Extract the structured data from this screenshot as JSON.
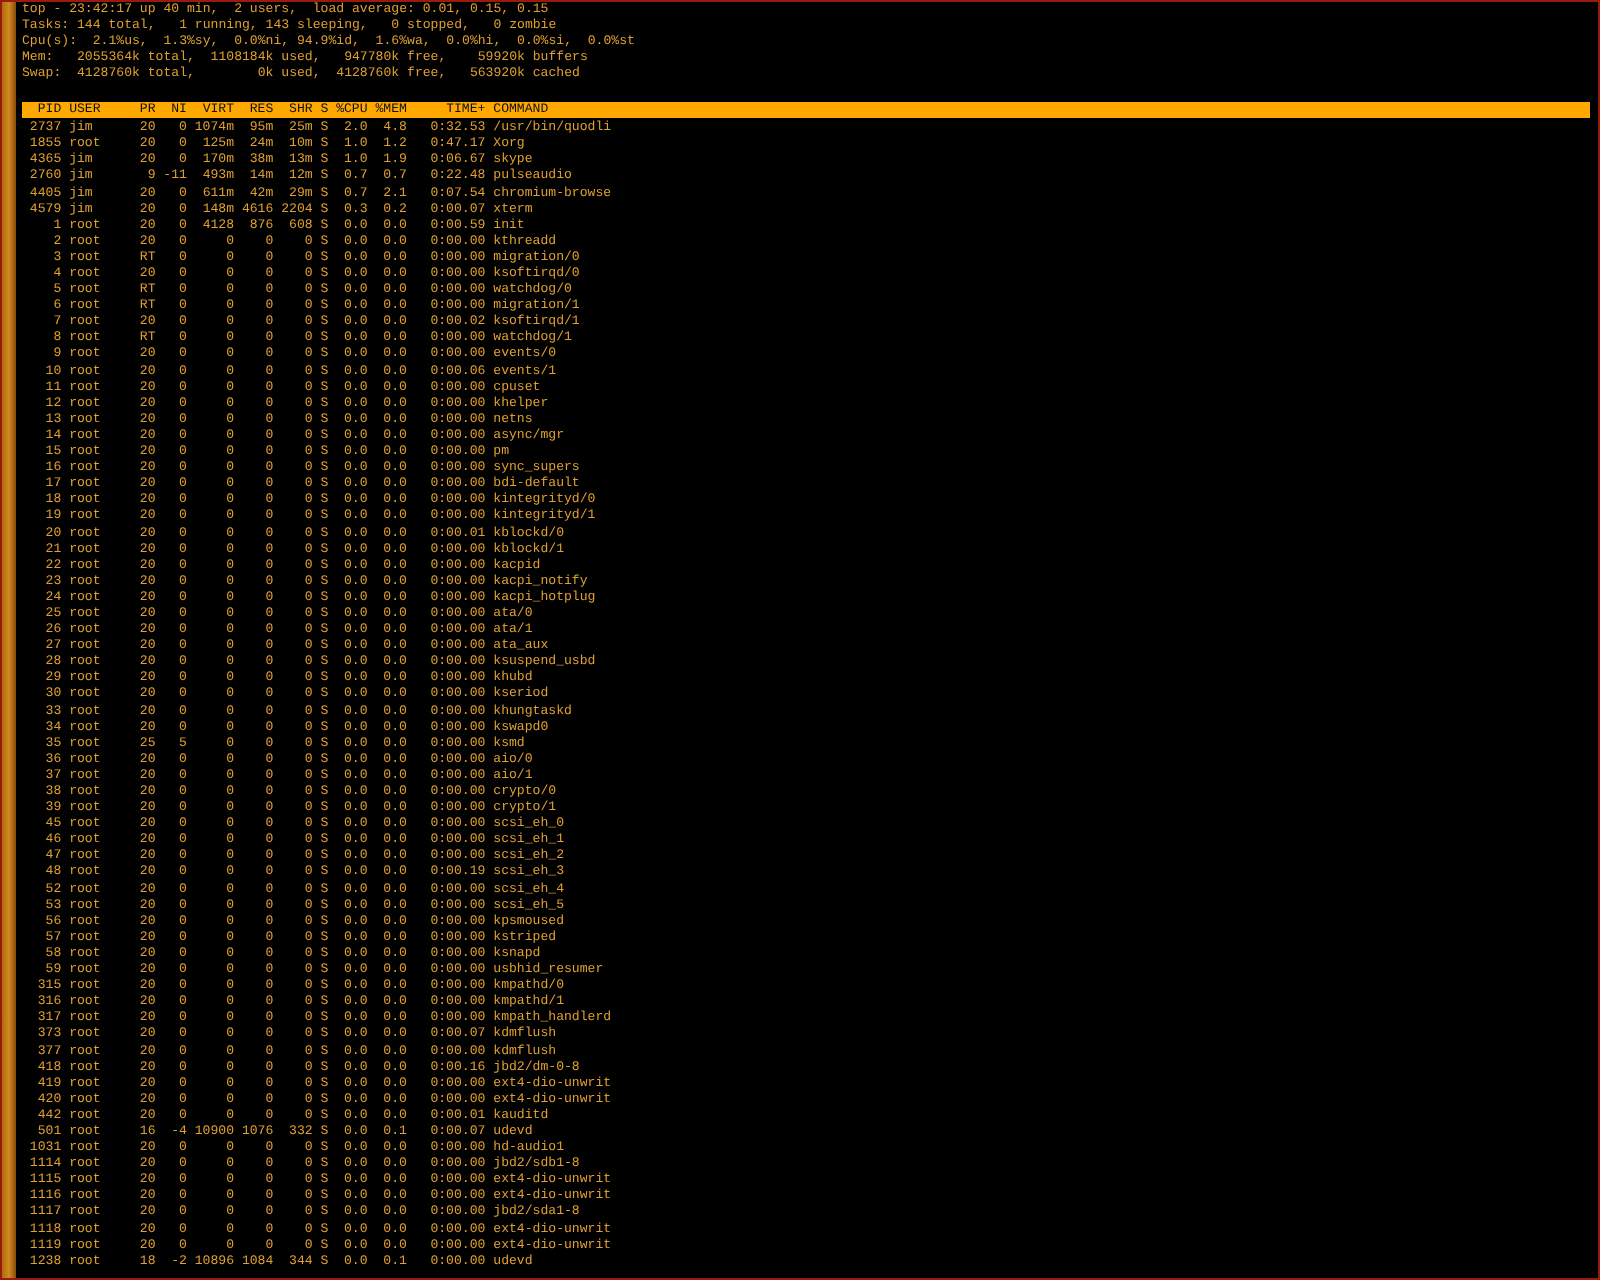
{
  "summary": [
    "top - 23:42:17 up 40 min,  2 users,  load average: 0.01, 0.15, 0.15",
    "Tasks: 144 total,   1 running, 143 sleeping,   0 stopped,   0 zombie",
    "Cpu(s):  2.1%us,  1.3%sy,  0.0%ni, 94.9%id,  1.6%wa,  0.0%hi,  0.0%si,  0.0%st",
    "Mem:   2055364k total,  1108184k used,   947780k free,    59920k buffers",
    "Swap:  4128760k total,        0k used,  4128760k free,   563920k cached"
  ],
  "table": {
    "columns": [
      "PID",
      "USER",
      "PR",
      "NI",
      "VIRT",
      "RES",
      "SHR",
      "S",
      "%CPU",
      "%MEM",
      "TIME+",
      "COMMAND"
    ],
    "rows": [
      [
        "2737",
        "jim",
        "20",
        "0",
        "1074m",
        "95m",
        "25m",
        "S",
        "2.0",
        "4.8",
        "0:32.53",
        "/usr/bin/quodli"
      ],
      [
        "1855",
        "root",
        "20",
        "0",
        "125m",
        "24m",
        "10m",
        "S",
        "1.0",
        "1.2",
        "0:47.17",
        "Xorg"
      ],
      [
        "4365",
        "jim",
        "20",
        "0",
        "170m",
        "38m",
        "13m",
        "S",
        "1.0",
        "1.9",
        "0:06.67",
        "skype"
      ],
      [
        "2760",
        "jim",
        "9",
        "-11",
        "493m",
        "14m",
        "12m",
        "S",
        "0.7",
        "0.7",
        "0:22.48",
        "pulseaudio"
      ],
      [
        "4405",
        "jim",
        "20",
        "0",
        "611m",
        "42m",
        "29m",
        "S",
        "0.7",
        "2.1",
        "0:07.54",
        "chromium-browse"
      ],
      [
        "4579",
        "jim",
        "20",
        "0",
        "148m",
        "4616",
        "2204",
        "S",
        "0.3",
        "0.2",
        "0:00.07",
        "xterm"
      ],
      [
        "1",
        "root",
        "20",
        "0",
        "4128",
        "876",
        "608",
        "S",
        "0.0",
        "0.0",
        "0:00.59",
        "init"
      ],
      [
        "2",
        "root",
        "20",
        "0",
        "0",
        "0",
        "0",
        "S",
        "0.0",
        "0.0",
        "0:00.00",
        "kthreadd"
      ],
      [
        "3",
        "root",
        "RT",
        "0",
        "0",
        "0",
        "0",
        "S",
        "0.0",
        "0.0",
        "0:00.00",
        "migration/0"
      ],
      [
        "4",
        "root",
        "20",
        "0",
        "0",
        "0",
        "0",
        "S",
        "0.0",
        "0.0",
        "0:00.00",
        "ksoftirqd/0"
      ],
      [
        "5",
        "root",
        "RT",
        "0",
        "0",
        "0",
        "0",
        "S",
        "0.0",
        "0.0",
        "0:00.00",
        "watchdog/0"
      ],
      [
        "6",
        "root",
        "RT",
        "0",
        "0",
        "0",
        "0",
        "S",
        "0.0",
        "0.0",
        "0:00.00",
        "migration/1"
      ],
      [
        "7",
        "root",
        "20",
        "0",
        "0",
        "0",
        "0",
        "S",
        "0.0",
        "0.0",
        "0:00.02",
        "ksoftirqd/1"
      ],
      [
        "8",
        "root",
        "RT",
        "0",
        "0",
        "0",
        "0",
        "S",
        "0.0",
        "0.0",
        "0:00.00",
        "watchdog/1"
      ],
      [
        "9",
        "root",
        "20",
        "0",
        "0",
        "0",
        "0",
        "S",
        "0.0",
        "0.0",
        "0:00.00",
        "events/0"
      ],
      [
        "10",
        "root",
        "20",
        "0",
        "0",
        "0",
        "0",
        "S",
        "0.0",
        "0.0",
        "0:00.06",
        "events/1"
      ],
      [
        "11",
        "root",
        "20",
        "0",
        "0",
        "0",
        "0",
        "S",
        "0.0",
        "0.0",
        "0:00.00",
        "cpuset"
      ],
      [
        "12",
        "root",
        "20",
        "0",
        "0",
        "0",
        "0",
        "S",
        "0.0",
        "0.0",
        "0:00.00",
        "khelper"
      ],
      [
        "13",
        "root",
        "20",
        "0",
        "0",
        "0",
        "0",
        "S",
        "0.0",
        "0.0",
        "0:00.00",
        "netns"
      ],
      [
        "14",
        "root",
        "20",
        "0",
        "0",
        "0",
        "0",
        "S",
        "0.0",
        "0.0",
        "0:00.00",
        "async/mgr"
      ],
      [
        "15",
        "root",
        "20",
        "0",
        "0",
        "0",
        "0",
        "S",
        "0.0",
        "0.0",
        "0:00.00",
        "pm"
      ],
      [
        "16",
        "root",
        "20",
        "0",
        "0",
        "0",
        "0",
        "S",
        "0.0",
        "0.0",
        "0:00.00",
        "sync_supers"
      ],
      [
        "17",
        "root",
        "20",
        "0",
        "0",
        "0",
        "0",
        "S",
        "0.0",
        "0.0",
        "0:00.00",
        "bdi-default"
      ],
      [
        "18",
        "root",
        "20",
        "0",
        "0",
        "0",
        "0",
        "S",
        "0.0",
        "0.0",
        "0:00.00",
        "kintegrityd/0"
      ],
      [
        "19",
        "root",
        "20",
        "0",
        "0",
        "0",
        "0",
        "S",
        "0.0",
        "0.0",
        "0:00.00",
        "kintegrityd/1"
      ],
      [
        "20",
        "root",
        "20",
        "0",
        "0",
        "0",
        "0",
        "S",
        "0.0",
        "0.0",
        "0:00.01",
        "kblockd/0"
      ],
      [
        "21",
        "root",
        "20",
        "0",
        "0",
        "0",
        "0",
        "S",
        "0.0",
        "0.0",
        "0:00.00",
        "kblockd/1"
      ],
      [
        "22",
        "root",
        "20",
        "0",
        "0",
        "0",
        "0",
        "S",
        "0.0",
        "0.0",
        "0:00.00",
        "kacpid"
      ],
      [
        "23",
        "root",
        "20",
        "0",
        "0",
        "0",
        "0",
        "S",
        "0.0",
        "0.0",
        "0:00.00",
        "kacpi_notify"
      ],
      [
        "24",
        "root",
        "20",
        "0",
        "0",
        "0",
        "0",
        "S",
        "0.0",
        "0.0",
        "0:00.00",
        "kacpi_hotplug"
      ],
      [
        "25",
        "root",
        "20",
        "0",
        "0",
        "0",
        "0",
        "S",
        "0.0",
        "0.0",
        "0:00.00",
        "ata/0"
      ],
      [
        "26",
        "root",
        "20",
        "0",
        "0",
        "0",
        "0",
        "S",
        "0.0",
        "0.0",
        "0:00.00",
        "ata/1"
      ],
      [
        "27",
        "root",
        "20",
        "0",
        "0",
        "0",
        "0",
        "S",
        "0.0",
        "0.0",
        "0:00.00",
        "ata_aux"
      ],
      [
        "28",
        "root",
        "20",
        "0",
        "0",
        "0",
        "0",
        "S",
        "0.0",
        "0.0",
        "0:00.00",
        "ksuspend_usbd"
      ],
      [
        "29",
        "root",
        "20",
        "0",
        "0",
        "0",
        "0",
        "S",
        "0.0",
        "0.0",
        "0:00.00",
        "khubd"
      ],
      [
        "30",
        "root",
        "20",
        "0",
        "0",
        "0",
        "0",
        "S",
        "0.0",
        "0.0",
        "0:00.00",
        "kseriod"
      ],
      [
        "33",
        "root",
        "20",
        "0",
        "0",
        "0",
        "0",
        "S",
        "0.0",
        "0.0",
        "0:00.00",
        "khungtaskd"
      ],
      [
        "34",
        "root",
        "20",
        "0",
        "0",
        "0",
        "0",
        "S",
        "0.0",
        "0.0",
        "0:00.00",
        "kswapd0"
      ],
      [
        "35",
        "root",
        "25",
        "5",
        "0",
        "0",
        "0",
        "S",
        "0.0",
        "0.0",
        "0:00.00",
        "ksmd"
      ],
      [
        "36",
        "root",
        "20",
        "0",
        "0",
        "0",
        "0",
        "S",
        "0.0",
        "0.0",
        "0:00.00",
        "aio/0"
      ],
      [
        "37",
        "root",
        "20",
        "0",
        "0",
        "0",
        "0",
        "S",
        "0.0",
        "0.0",
        "0:00.00",
        "aio/1"
      ],
      [
        "38",
        "root",
        "20",
        "0",
        "0",
        "0",
        "0",
        "S",
        "0.0",
        "0.0",
        "0:00.00",
        "crypto/0"
      ],
      [
        "39",
        "root",
        "20",
        "0",
        "0",
        "0",
        "0",
        "S",
        "0.0",
        "0.0",
        "0:00.00",
        "crypto/1"
      ],
      [
        "45",
        "root",
        "20",
        "0",
        "0",
        "0",
        "0",
        "S",
        "0.0",
        "0.0",
        "0:00.00",
        "scsi_eh_0"
      ],
      [
        "46",
        "root",
        "20",
        "0",
        "0",
        "0",
        "0",
        "S",
        "0.0",
        "0.0",
        "0:00.00",
        "scsi_eh_1"
      ],
      [
        "47",
        "root",
        "20",
        "0",
        "0",
        "0",
        "0",
        "S",
        "0.0",
        "0.0",
        "0:00.00",
        "scsi_eh_2"
      ],
      [
        "48",
        "root",
        "20",
        "0",
        "0",
        "0",
        "0",
        "S",
        "0.0",
        "0.0",
        "0:00.19",
        "scsi_eh_3"
      ],
      [
        "52",
        "root",
        "20",
        "0",
        "0",
        "0",
        "0",
        "S",
        "0.0",
        "0.0",
        "0:00.00",
        "scsi_eh_4"
      ],
      [
        "53",
        "root",
        "20",
        "0",
        "0",
        "0",
        "0",
        "S",
        "0.0",
        "0.0",
        "0:00.00",
        "scsi_eh_5"
      ],
      [
        "56",
        "root",
        "20",
        "0",
        "0",
        "0",
        "0",
        "S",
        "0.0",
        "0.0",
        "0:00.00",
        "kpsmoused"
      ],
      [
        "57",
        "root",
        "20",
        "0",
        "0",
        "0",
        "0",
        "S",
        "0.0",
        "0.0",
        "0:00.00",
        "kstriped"
      ],
      [
        "58",
        "root",
        "20",
        "0",
        "0",
        "0",
        "0",
        "S",
        "0.0",
        "0.0",
        "0:00.00",
        "ksnapd"
      ],
      [
        "59",
        "root",
        "20",
        "0",
        "0",
        "0",
        "0",
        "S",
        "0.0",
        "0.0",
        "0:00.00",
        "usbhid_resumer"
      ],
      [
        "315",
        "root",
        "20",
        "0",
        "0",
        "0",
        "0",
        "S",
        "0.0",
        "0.0",
        "0:00.00",
        "kmpathd/0"
      ],
      [
        "316",
        "root",
        "20",
        "0",
        "0",
        "0",
        "0",
        "S",
        "0.0",
        "0.0",
        "0:00.00",
        "kmpathd/1"
      ],
      [
        "317",
        "root",
        "20",
        "0",
        "0",
        "0",
        "0",
        "S",
        "0.0",
        "0.0",
        "0:00.00",
        "kmpath_handlerd"
      ],
      [
        "373",
        "root",
        "20",
        "0",
        "0",
        "0",
        "0",
        "S",
        "0.0",
        "0.0",
        "0:00.07",
        "kdmflush"
      ],
      [
        "377",
        "root",
        "20",
        "0",
        "0",
        "0",
        "0",
        "S",
        "0.0",
        "0.0",
        "0:00.00",
        "kdmflush"
      ],
      [
        "418",
        "root",
        "20",
        "0",
        "0",
        "0",
        "0",
        "S",
        "0.0",
        "0.0",
        "0:00.16",
        "jbd2/dm-0-8"
      ],
      [
        "419",
        "root",
        "20",
        "0",
        "0",
        "0",
        "0",
        "S",
        "0.0",
        "0.0",
        "0:00.00",
        "ext4-dio-unwrit"
      ],
      [
        "420",
        "root",
        "20",
        "0",
        "0",
        "0",
        "0",
        "S",
        "0.0",
        "0.0",
        "0:00.00",
        "ext4-dio-unwrit"
      ],
      [
        "442",
        "root",
        "20",
        "0",
        "0",
        "0",
        "0",
        "S",
        "0.0",
        "0.0",
        "0:00.01",
        "kauditd"
      ],
      [
        "501",
        "root",
        "16",
        "-4",
        "10900",
        "1076",
        "332",
        "S",
        "0.0",
        "0.1",
        "0:00.07",
        "udevd"
      ],
      [
        "1031",
        "root",
        "20",
        "0",
        "0",
        "0",
        "0",
        "S",
        "0.0",
        "0.0",
        "0:00.00",
        "hd-audio1"
      ],
      [
        "1114",
        "root",
        "20",
        "0",
        "0",
        "0",
        "0",
        "S",
        "0.0",
        "0.0",
        "0:00.00",
        "jbd2/sdb1-8"
      ],
      [
        "1115",
        "root",
        "20",
        "0",
        "0",
        "0",
        "0",
        "S",
        "0.0",
        "0.0",
        "0:00.00",
        "ext4-dio-unwrit"
      ],
      [
        "1116",
        "root",
        "20",
        "0",
        "0",
        "0",
        "0",
        "S",
        "0.0",
        "0.0",
        "0:00.00",
        "ext4-dio-unwrit"
      ],
      [
        "1117",
        "root",
        "20",
        "0",
        "0",
        "0",
        "0",
        "S",
        "0.0",
        "0.0",
        "0:00.00",
        "jbd2/sda1-8"
      ],
      [
        "1118",
        "root",
        "20",
        "0",
        "0",
        "0",
        "0",
        "S",
        "0.0",
        "0.0",
        "0:00.00",
        "ext4-dio-unwrit"
      ],
      [
        "1119",
        "root",
        "20",
        "0",
        "0",
        "0",
        "0",
        "S",
        "0.0",
        "0.0",
        "0:00.00",
        "ext4-dio-unwrit"
      ],
      [
        "1238",
        "root",
        "18",
        "-2",
        "10896",
        "1084",
        "344",
        "S",
        "0.0",
        "0.1",
        "0:00.00",
        "udevd"
      ]
    ]
  }
}
